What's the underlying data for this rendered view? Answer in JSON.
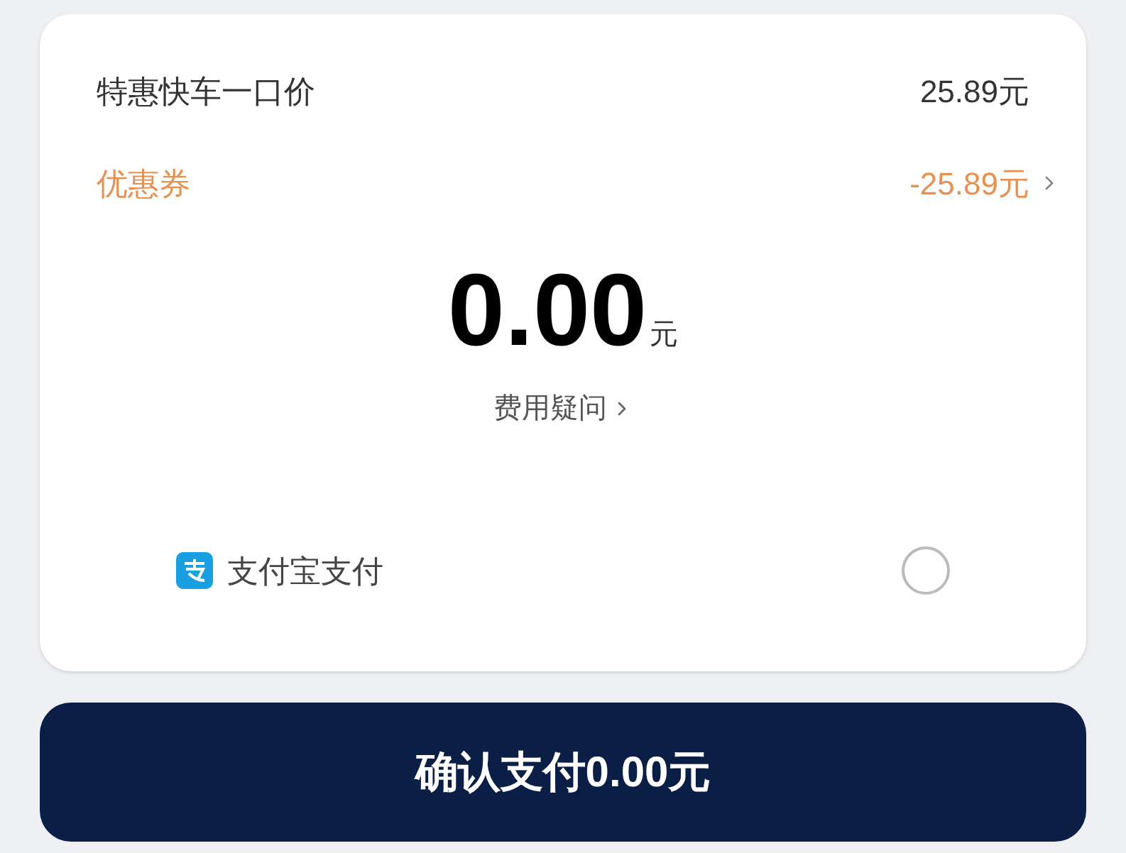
{
  "fare_rows": [
    {
      "kind": "price",
      "label": "特惠快车一口价",
      "value": "25.89元"
    },
    {
      "kind": "coupon",
      "label": "优惠券",
      "value": "-25.89元"
    }
  ],
  "total": {
    "amount": "0.00",
    "unit": "元"
  },
  "fee_question": {
    "label": "费用疑问"
  },
  "payment_methods": [
    {
      "label": "支付宝支付",
      "selected": false
    }
  ],
  "confirm_button": {
    "label": "确认支付0.00元"
  }
}
